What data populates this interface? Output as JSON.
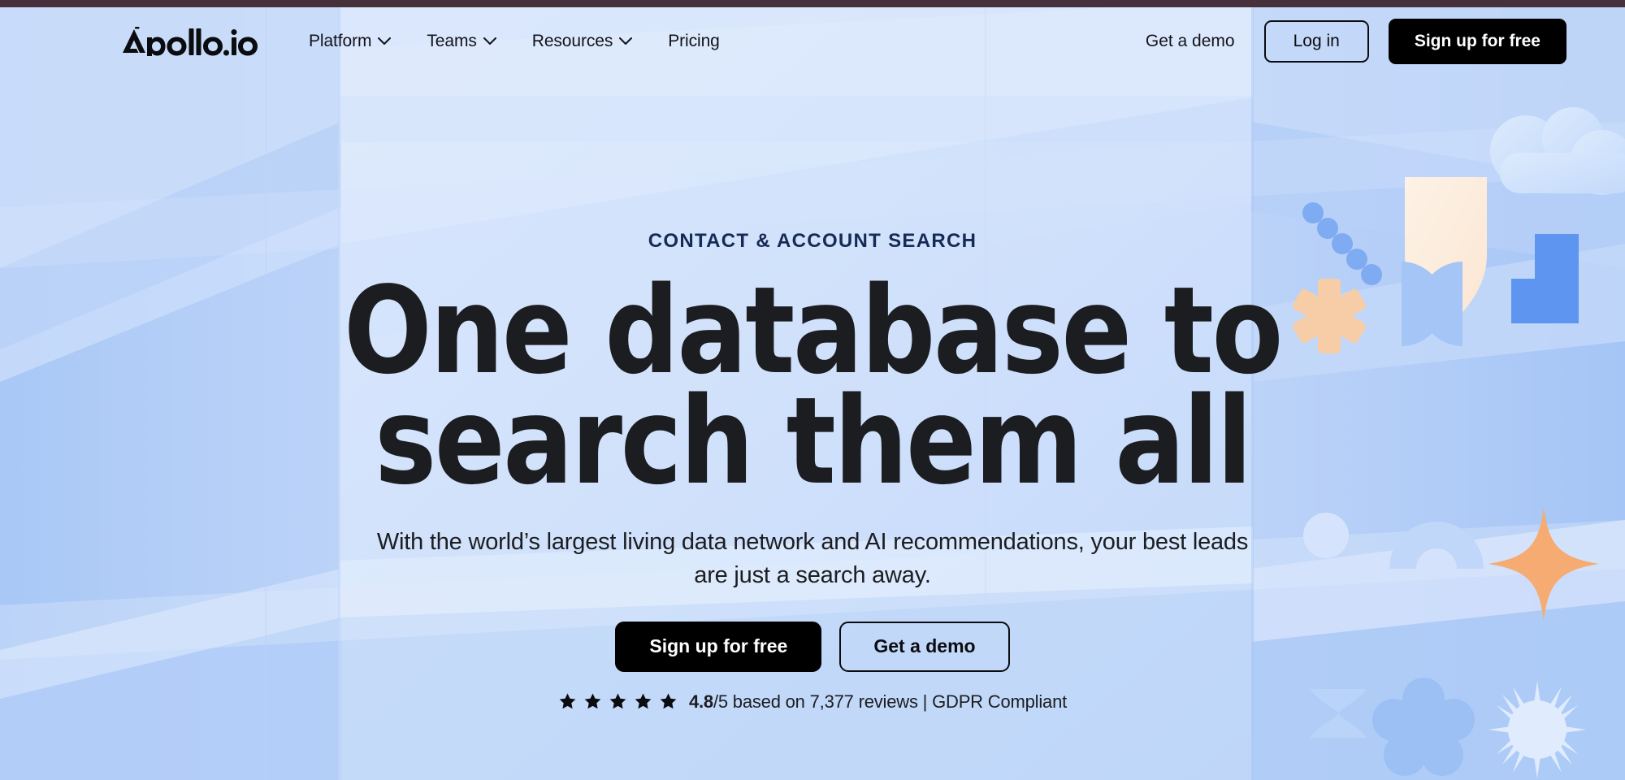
{
  "brand": {
    "name": "Apollo.io",
    "accent_dark": "#46303c",
    "eyebrow_color": "#152a56",
    "cta_dark": "#000000"
  },
  "nav": {
    "items": [
      {
        "label": "Platform",
        "has_chevron": true,
        "icon": "chevron-down-icon"
      },
      {
        "label": "Teams",
        "has_chevron": true,
        "icon": "chevron-down-icon"
      },
      {
        "label": "Resources",
        "has_chevron": true,
        "icon": "chevron-down-icon"
      },
      {
        "label": "Pricing",
        "has_chevron": false,
        "icon": ""
      }
    ],
    "demo_label": "Get a demo",
    "login_label": "Log in",
    "signup_label": "Sign up for free"
  },
  "hero": {
    "eyebrow": "CONTACT & ACCOUNT SEARCH",
    "headline_line1": "One database to",
    "headline_line2": "search them all",
    "subheadline": "With the world’s largest living data network and AI recommendations, your best leads are just a search away.",
    "cta_primary": "Sign up for free",
    "cta_secondary": "Get a demo",
    "rating": {
      "stars": 5,
      "star_glyph": "★",
      "score": "4.8",
      "suffix": "/5 based on 7,377 reviews | GDPR Compliant"
    }
  },
  "decor": {
    "shapes": [
      "dotted-diagonal-line-icon",
      "shield-icon",
      "cloud-icon",
      "asterisk-icon",
      "double-semicircle-icon",
      "stepped-block-icon",
      "circle-icon",
      "arch-icon",
      "sparkle-icon",
      "hourglass-icon",
      "flower-icon",
      "starburst-icon"
    ],
    "colors": {
      "cream": "#fdf0e0",
      "peach": "#f6c49c",
      "orange": "#f5a96e",
      "blue_strong": "#5e95f0",
      "blue_mid": "#a9c8f6",
      "blue_pale": "#cfe0fb"
    }
  }
}
